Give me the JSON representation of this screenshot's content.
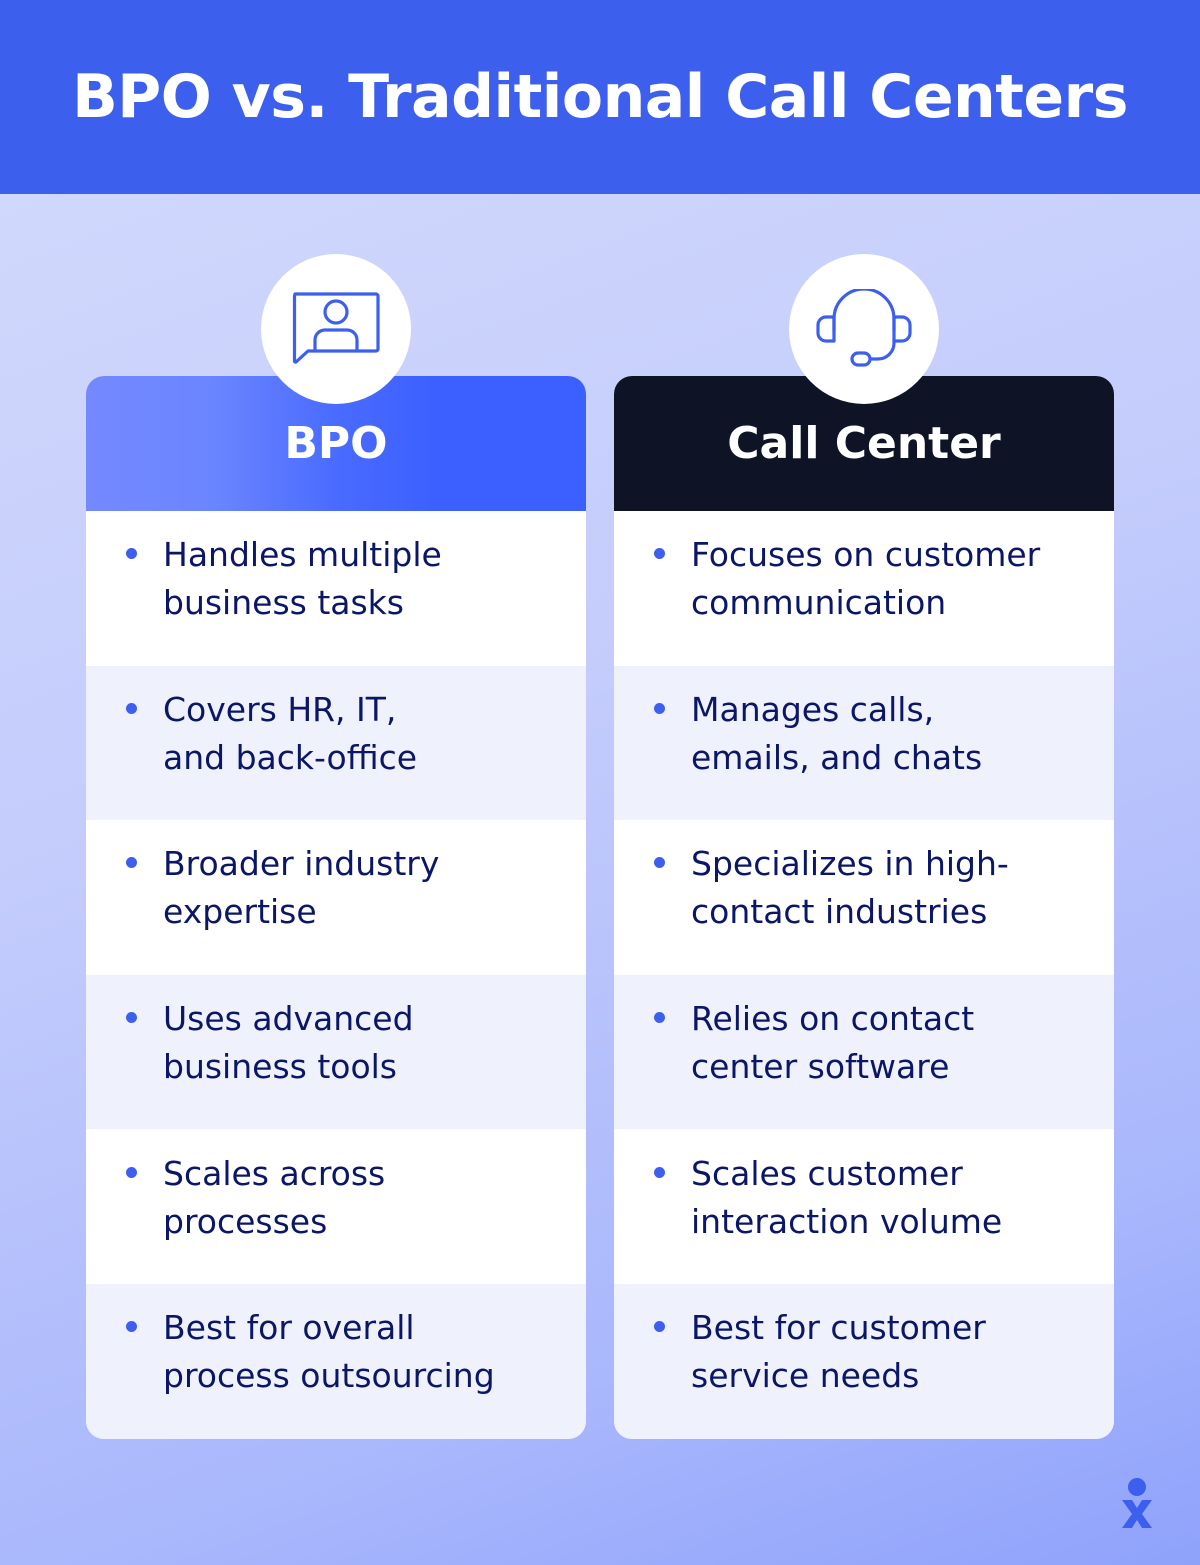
{
  "header": {
    "title": "BPO vs. Traditional Call Centers"
  },
  "columns": [
    {
      "title": "BPO",
      "icon": "video-chat-person-icon",
      "items": [
        "Handles multiple\nbusiness tasks",
        "Covers HR, IT,\nand back-office",
        "Broader industry\nexpertise",
        "Uses advanced\nbusiness tools",
        "Scales across\nprocesses",
        "Best for overall\nprocess outsourcing"
      ]
    },
    {
      "title": "Call Center",
      "icon": "headset-icon",
      "items": [
        "Focuses on customer\ncommunication",
        "Manages calls,\nemails, and chats",
        "Specializes in high-\ncontact industries",
        "Relies on contact\ncenter software",
        "Scales customer\ninteraction volume",
        "Best for customer\nservice needs"
      ]
    }
  ],
  "colors": {
    "accent": "#3d5fed",
    "text_dark": "#0b1766",
    "call_center_header": "#0e1326",
    "row_alt": "#eff2fd"
  }
}
